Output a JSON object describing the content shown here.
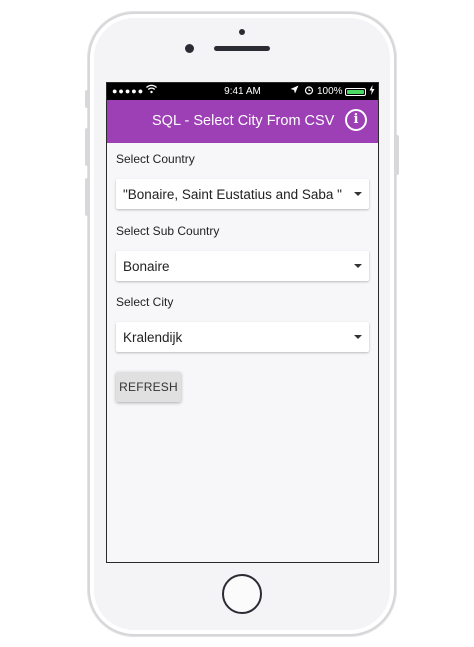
{
  "status_bar": {
    "signal": "●●●●●",
    "wifi_icon": "wifi-icon",
    "time": "9:41 AM",
    "location_icon": "location-arrow-icon",
    "alarm_icon": "alarm-clock-icon",
    "battery_percent": "100%",
    "battery_level": 1.0,
    "battery_color": "#4cd964",
    "charging_icon": "lightning-bolt-icon"
  },
  "app_bar": {
    "title": "SQL - Select City From CSV",
    "info_icon": "info-icon",
    "color": "#9d3fb5"
  },
  "form": {
    "country": {
      "label": "Select Country",
      "value": "\"Bonaire, Saint Eustatius and Saba \""
    },
    "sub_country": {
      "label": "Select Sub Country",
      "value": "Bonaire"
    },
    "city": {
      "label": "Select City",
      "value": "Kralendijk"
    },
    "refresh_label": "REFRESH"
  }
}
